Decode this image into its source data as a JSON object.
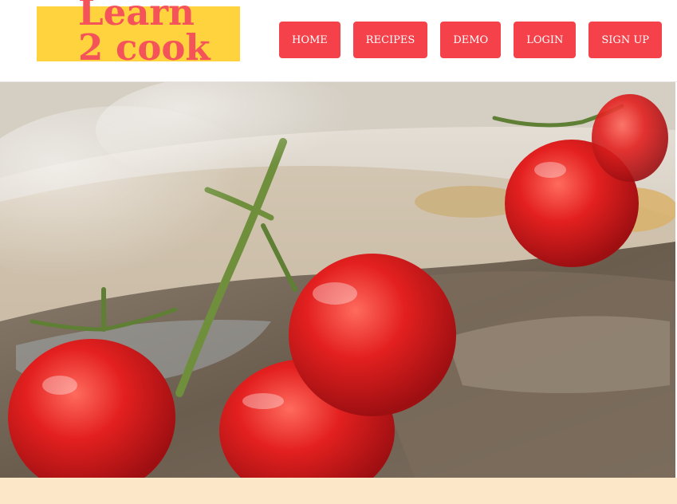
{
  "brand": {
    "line1": "Learn",
    "line2": "2 cook"
  },
  "nav": {
    "items": [
      {
        "label": "HOME"
      },
      {
        "label": "RECIPES"
      },
      {
        "label": "DEMO"
      },
      {
        "label": "LOGIN"
      },
      {
        "label": "SIGN UP"
      }
    ]
  },
  "colors": {
    "logo_bg": "#ffd33d",
    "logo_text": "#f5535a",
    "nav_button": "#f5414a",
    "footer_band": "#fde7c9"
  },
  "hero": {
    "image": "roasted-cherry-tomatoes-on-steak-photo"
  }
}
